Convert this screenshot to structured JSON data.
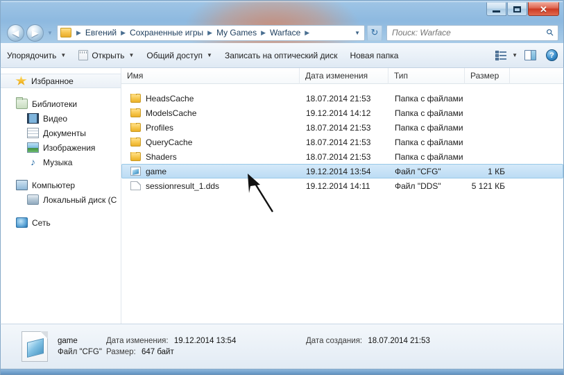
{
  "window": {
    "caption_buttons": {
      "minimize": "minimize-icon",
      "maximize": "maximize-icon",
      "close": "✕"
    }
  },
  "navigation": {
    "back_glyph": "◀",
    "forward_glyph": "▶",
    "dropdown_glyph": "▼",
    "refresh_glyph": "↻",
    "breadcrumb": [
      "Евгений",
      "Сохраненные игры",
      "My Games",
      "Warface"
    ],
    "breadcrumb_separator": "▶",
    "breadcrumb_dropdown": "▼"
  },
  "search": {
    "placeholder": "Поиск: Warface",
    "icon": "search-icon"
  },
  "toolbar": {
    "organize": "Упорядочить",
    "open": "Открыть",
    "share": "Общий доступ",
    "burn": "Записать на оптический диск",
    "new_folder": "Новая папка",
    "caret": "▼",
    "help_glyph": "?"
  },
  "sidebar": {
    "groups": [
      {
        "header": {
          "label": "Избранное",
          "icon": "star-icon",
          "selected": true
        },
        "children": []
      },
      {
        "header": {
          "label": "Библиотеки",
          "icon": "library-icon",
          "selected": false
        },
        "children": [
          {
            "label": "Видео",
            "icon": "video-icon"
          },
          {
            "label": "Документы",
            "icon": "document-icon"
          },
          {
            "label": "Изображения",
            "icon": "picture-icon"
          },
          {
            "label": "Музыка",
            "icon": "music-icon"
          }
        ]
      },
      {
        "header": {
          "label": "Компьютер",
          "icon": "computer-icon",
          "selected": false
        },
        "children": [
          {
            "label": "Локальный диск (C",
            "icon": "disk-icon"
          }
        ]
      },
      {
        "header": {
          "label": "Сеть",
          "icon": "network-icon",
          "selected": false
        },
        "children": []
      }
    ]
  },
  "filelist": {
    "columns": [
      "Имя",
      "Дата изменения",
      "Тип",
      "Размер"
    ],
    "rows": [
      {
        "name": "HeadsCache",
        "date": "18.07.2014 21:53",
        "type": "Папка с файлами",
        "size": "",
        "icon": "folder-icon",
        "selected": false
      },
      {
        "name": "ModelsCache",
        "date": "19.12.2014 14:12",
        "type": "Папка с файлами",
        "size": "",
        "icon": "folder-icon",
        "selected": false
      },
      {
        "name": "Profiles",
        "date": "18.07.2014 21:53",
        "type": "Папка с файлами",
        "size": "",
        "icon": "folder-icon",
        "selected": false
      },
      {
        "name": "QueryCache",
        "date": "18.07.2014 21:53",
        "type": "Папка с файлами",
        "size": "",
        "icon": "folder-icon",
        "selected": false
      },
      {
        "name": "Shaders",
        "date": "18.07.2014 21:53",
        "type": "Папка с файлами",
        "size": "",
        "icon": "folder-icon",
        "selected": false
      },
      {
        "name": "game",
        "date": "19.12.2014 13:54",
        "type": "Файл \"CFG\"",
        "size": "1 КБ",
        "icon": "cfg-file-icon",
        "selected": true
      },
      {
        "name": "sessionresult_1.dds",
        "date": "19.12.2014 14:11",
        "type": "Файл \"DDS\"",
        "size": "5 121 КБ",
        "icon": "dds-file-icon",
        "selected": false
      }
    ]
  },
  "details": {
    "file_name": "game",
    "file_type": "Файл \"CFG\"",
    "modified_label": "Дата изменения:",
    "modified_value": "19.12.2014 13:54",
    "created_label": "Дата создания:",
    "created_value": "18.07.2014 21:53",
    "size_label": "Размер:",
    "size_value": "647 байт"
  },
  "colors": {
    "accent": "#3b6ea5",
    "selection": "#bcdcf4",
    "close_button": "#cd3a23",
    "folder": "#f8ca52"
  }
}
